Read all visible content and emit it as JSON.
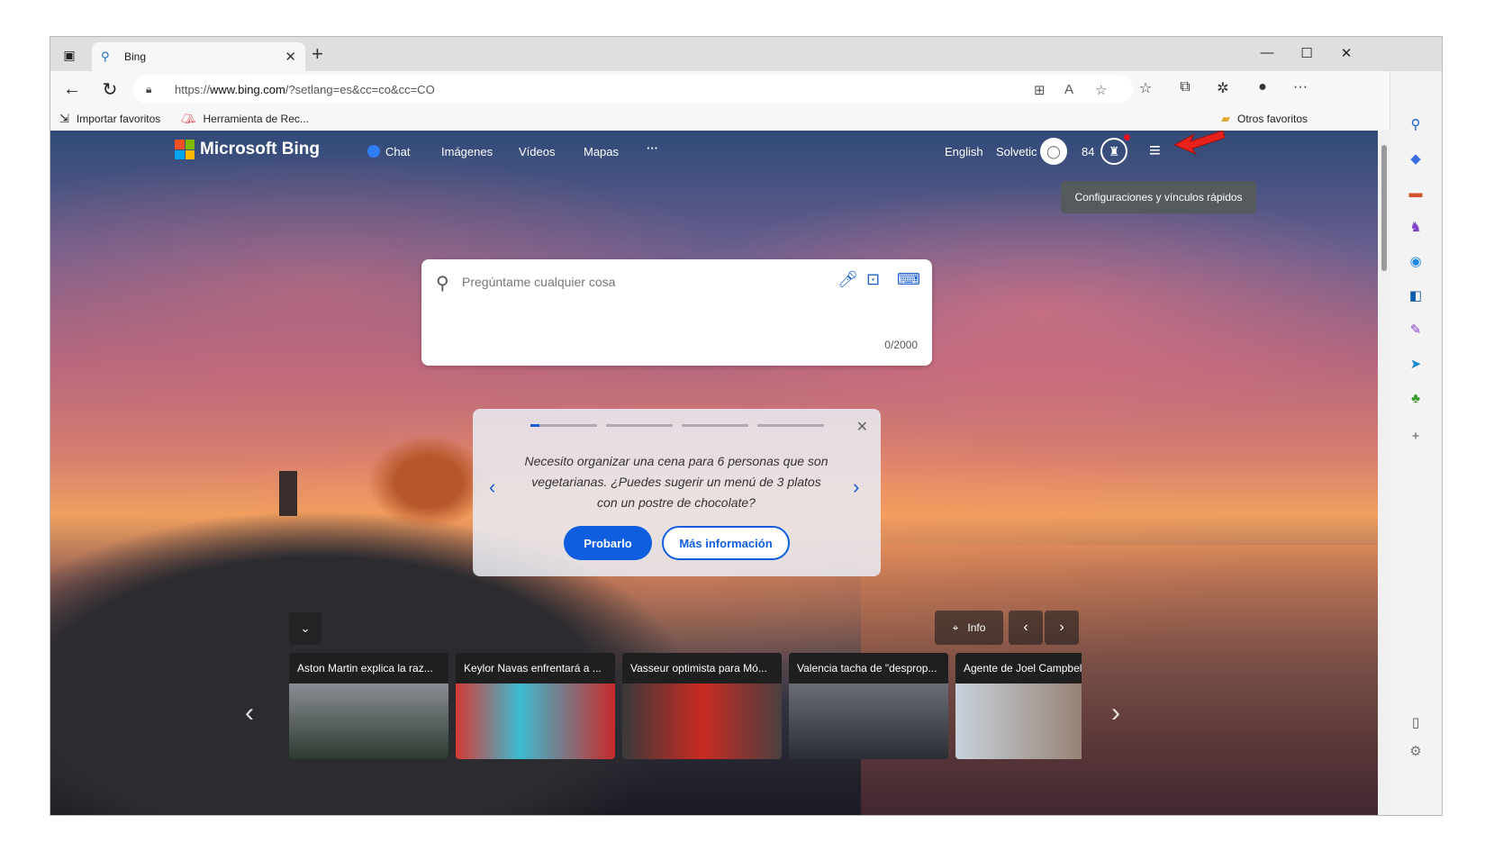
{
  "browser": {
    "tab_title": "Bing",
    "tab_favicon": "search-icon",
    "url_scheme": "https://",
    "url_host": "www.bing.com",
    "url_path": "/?setlang=es&cc=co&cc=CO"
  },
  "favorites_bar": {
    "items": [
      {
        "label": "Importar favoritos",
        "icon": "import-icon"
      },
      {
        "label": "Herramienta de Rec...",
        "icon": "tool-icon"
      }
    ],
    "other_favorites": "Otros favoritos"
  },
  "bing": {
    "logo_text": "Microsoft Bing",
    "nav": [
      "Chat",
      "Imágenes",
      "Vídeos",
      "Mapas",
      "···"
    ],
    "language": "English",
    "user_name": "Solvetic",
    "points": "84",
    "tooltip": "Configuraciones y vínculos rápidos",
    "search_placeholder": "Pregúntame cualquier cosa",
    "char_count": "0/2000",
    "suggestion_text": "Necesito organizar una cena para 6 personas que son vegetarianas. ¿Puedes sugerir un menú de 3 platos con un postre de chocolate?",
    "try_label": "Probarlo",
    "more_label": "Más información",
    "info_label": "Info",
    "news": [
      "Aston Martin explica la raz...",
      "Keylor Navas enfrentará a ...",
      "Vasseur optimista para Mó...",
      "Valencia tacha de \"desprop...",
      "Agente de Joel Campbell"
    ]
  },
  "colors": {
    "accent": "#0f5ee0",
    "bing_blue": "#1a5fd0",
    "notification_dot": "#e81123",
    "arrow_red": "#e8221b"
  }
}
